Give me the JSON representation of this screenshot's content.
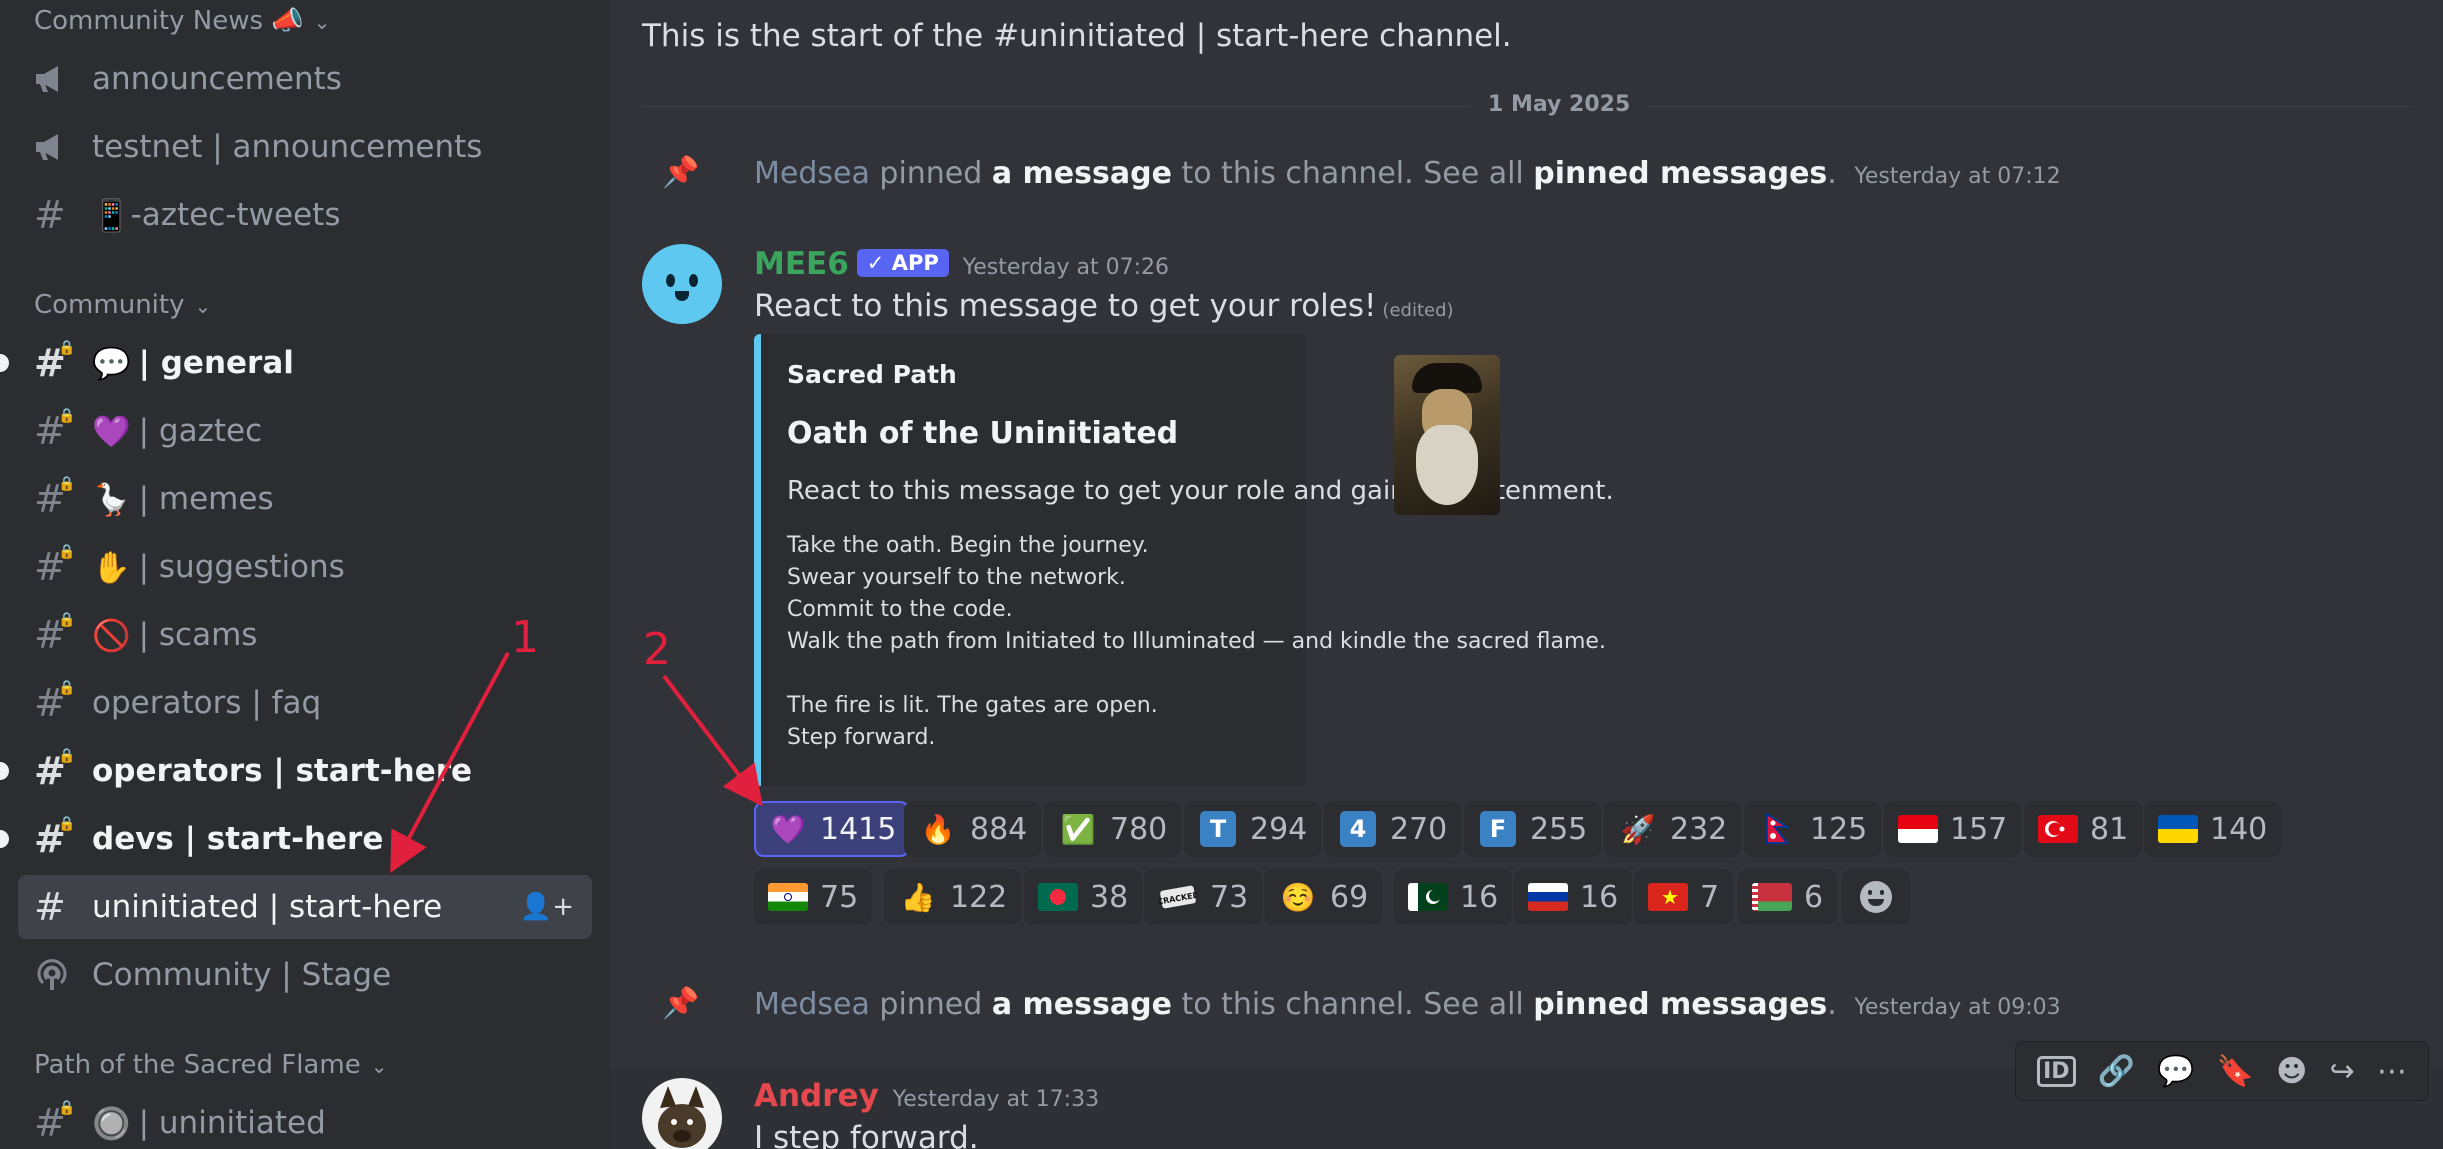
{
  "sidebar": {
    "categories": [
      {
        "label": "Community News 📣"
      },
      {
        "label": "Community"
      },
      {
        "label": "Path of the Sacred Flame"
      }
    ],
    "channels": [
      {
        "label": "announcements",
        "icon": "megaphone-icon"
      },
      {
        "label": "testnet | announcements",
        "icon": "megaphone-icon"
      },
      {
        "label": "-aztec-tweets",
        "icon": "hash-icon",
        "emoji": "📱"
      },
      {
        "label": "| general",
        "icon": "hash-icon",
        "emoji": "💬"
      },
      {
        "label": "| gaztec",
        "icon": "hash-icon",
        "emoji": "💜"
      },
      {
        "label": "| memes",
        "icon": "hash-icon",
        "emoji": "🪿"
      },
      {
        "label": "| suggestions",
        "icon": "hash-icon",
        "emoji": "✋"
      },
      {
        "label": "| scams",
        "icon": "hash-icon",
        "emoji": "🚫"
      },
      {
        "label": "operators | faq",
        "icon": "hash-icon"
      },
      {
        "label": "operators | start-here",
        "icon": "hash-icon"
      },
      {
        "label": "devs | start-here",
        "icon": "hash-icon"
      },
      {
        "label": "uninitiated | start-here",
        "icon": "hash-icon"
      },
      {
        "label": "Community | Stage",
        "icon": "stage-icon"
      },
      {
        "label": "| uninitiated",
        "icon": "hash-icon",
        "emoji": "🔘"
      }
    ]
  },
  "channel": {
    "start_text": "This is the start of the #uninitiated | start-here channel.",
    "date_divider": "1 May 2025"
  },
  "pins": [
    {
      "user": "Medsea",
      "text1": "pinned",
      "link1": "a message",
      "text2": "to this channel. See all",
      "link2": "pinned messages",
      "dot": ".",
      "time": "Yesterday at 07:12"
    },
    {
      "user": "Medsea",
      "text1": "pinned",
      "link1": "a message",
      "text2": "to this channel. See all",
      "link2": "pinned messages",
      "dot": ".",
      "time": "Yesterday at 09:03"
    }
  ],
  "mee6": {
    "name": "MEE6",
    "badge": "✓ APP",
    "time": "Yesterday at 07:26",
    "text": "React to this message to get your roles!",
    "edited": "(edited)",
    "embed": {
      "author": "Sacred Path",
      "title": "Oath of the Uninitiated",
      "description": "React to this message to get your role and gain enlightenment.",
      "body": "Take the oath. Begin the journey.\nSwear yourself to the network.\nCommit to the code.\nWalk the path from Initiated to Illuminated — and kindle the sacred flame.\n\nThe fire is lit. The gates are open.\nStep forward."
    },
    "reactions": [
      {
        "emoji": "💜",
        "count": "1415",
        "me": true
      },
      {
        "emoji": "🔥",
        "count": "884"
      },
      {
        "emoji": "✅",
        "count": "780"
      },
      {
        "emoji": "T",
        "count": "294",
        "tile": true
      },
      {
        "emoji": "4",
        "count": "270",
        "tile": true
      },
      {
        "emoji": "F",
        "count": "255",
        "tile": true
      },
      {
        "emoji": "🚀",
        "count": "232"
      },
      {
        "emoji": "flag-np",
        "count": "125"
      },
      {
        "emoji": "flag-id",
        "count": "157"
      },
      {
        "emoji": "flag-tr",
        "count": "81"
      },
      {
        "emoji": "flag-ua",
        "count": "140"
      },
      {
        "emoji": "flag-in",
        "count": "75"
      },
      {
        "emoji": "👍",
        "count": "122"
      },
      {
        "emoji": "flag-bd",
        "count": "38"
      },
      {
        "emoji": "cracked",
        "count": "73"
      },
      {
        "emoji": "☺️",
        "count": "69"
      },
      {
        "emoji": "flag-pk",
        "count": "16"
      },
      {
        "emoji": "flag-ru",
        "count": "16"
      },
      {
        "emoji": "flag-vn",
        "count": "7"
      },
      {
        "emoji": "flag-by",
        "count": "6"
      }
    ]
  },
  "andrey": {
    "name": "Andrey",
    "time": "Yesterday at 17:33",
    "text": "I step forward."
  },
  "annotations": {
    "one": "1",
    "two": "2"
  },
  "colors": {
    "accent": "#5865f2",
    "mee6_name": "#3ba55d",
    "andrey_name": "#e5484d",
    "embed_bar": "#5ec8f0",
    "annotation": "#e0203c"
  }
}
